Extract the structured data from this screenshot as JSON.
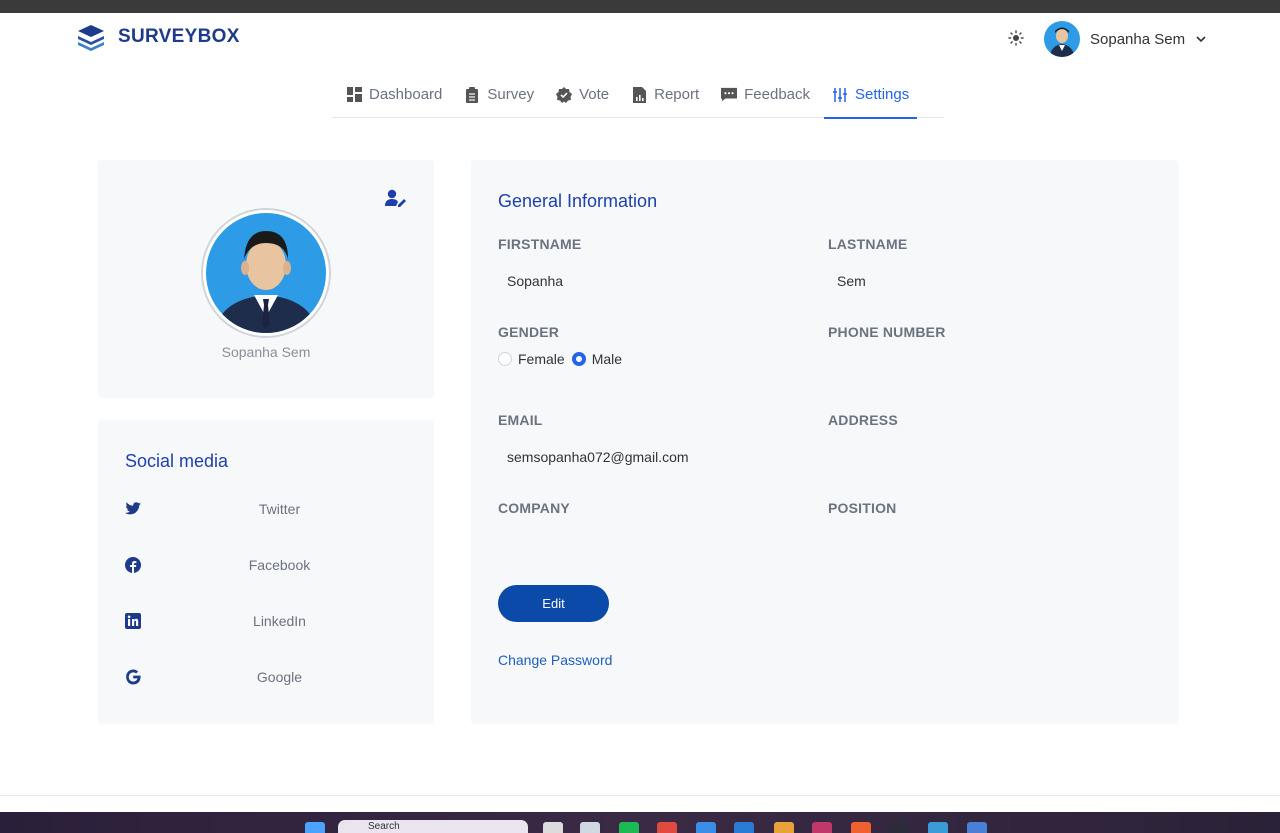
{
  "brand": {
    "name": "SURVEYBOX"
  },
  "user": {
    "name": "Sopanha Sem"
  },
  "nav": {
    "items": [
      {
        "label": "Dashboard",
        "icon": "dashboard-icon"
      },
      {
        "label": "Survey",
        "icon": "clipboard-icon"
      },
      {
        "label": "Vote",
        "icon": "badge-check-icon"
      },
      {
        "label": "Report",
        "icon": "report-icon"
      },
      {
        "label": "Feedback",
        "icon": "message-icon"
      },
      {
        "label": "Settings",
        "icon": "sliders-icon",
        "active": true
      }
    ]
  },
  "profile": {
    "name": "Sopanha Sem"
  },
  "social": {
    "title": "Social media",
    "items": [
      {
        "label": "Twitter",
        "icon": "twitter-icon"
      },
      {
        "label": "Facebook",
        "icon": "facebook-icon"
      },
      {
        "label": "LinkedIn",
        "icon": "linkedin-icon"
      },
      {
        "label": "Google",
        "icon": "google-icon"
      }
    ]
  },
  "info": {
    "title": "General Information",
    "firstname_label": "FIRSTNAME",
    "firstname": "Sopanha",
    "lastname_label": "LASTNAME",
    "lastname": "Sem",
    "gender_label": "GENDER",
    "gender_options": [
      "Female",
      "Male"
    ],
    "gender_selected": "Male",
    "phone_label": "PHONE NUMBER",
    "email_label": "EMAIL",
    "email": "semsopanha072@gmail.com",
    "address_label": "ADDRESS",
    "company_label": "COMPANY",
    "position_label": "POSITION",
    "edit_label": "Edit",
    "change_password_label": "Change Password"
  },
  "taskbar": {
    "search_label": "Search"
  },
  "colors": {
    "accent": "#2563eb",
    "brand": "#1e3a8a",
    "button": "#0b4aa8",
    "card_bg": "#f7f8fa"
  }
}
